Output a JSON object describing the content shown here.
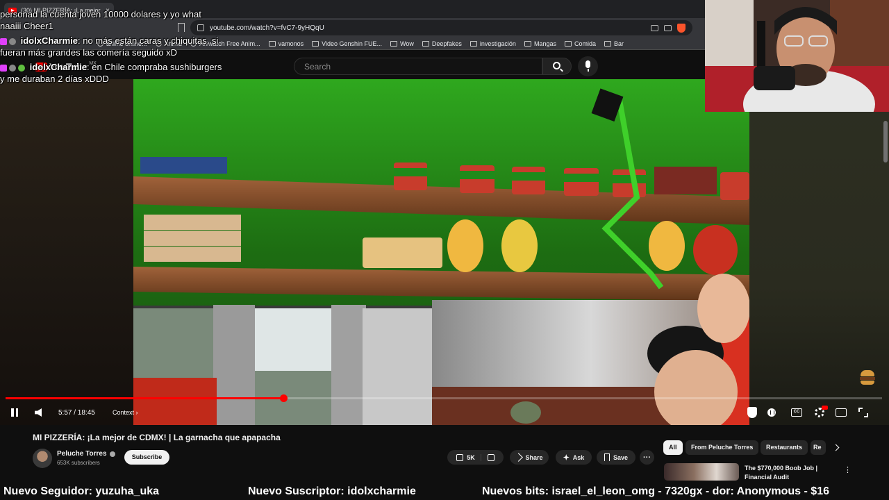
{
  "browser": {
    "tab_title": "(30) MI PIZZERÍA: ¡La mejor d",
    "tab_close": "×",
    "url": "youtube.com/watch?v=fvC7-9yHQqU",
    "bookmarks": [
      {
        "label": "anime online...",
        "icon": "globe-icon"
      },
      {
        "label": "Animu",
        "icon": "globe-icon"
      },
      {
        "label": "Aniwatch Free Anim...",
        "icon": "globe-icon"
      },
      {
        "label": "vamonos",
        "icon": "folder-icon"
      },
      {
        "label": "Video Genshin FUE...",
        "icon": "folder-icon"
      },
      {
        "label": "Wow",
        "icon": "folder-icon"
      },
      {
        "label": "Deepfakes",
        "icon": "folder-icon"
      },
      {
        "label": "investigación",
        "icon": "folder-icon"
      },
      {
        "label": "Mangas",
        "icon": "folder-icon"
      },
      {
        "label": "Comida",
        "icon": "folder-icon"
      },
      {
        "label": "Bar",
        "icon": "folder-icon"
      }
    ]
  },
  "youtube": {
    "logo_text": "YouTube",
    "region": "MX",
    "search_placeholder": "Search"
  },
  "player": {
    "progress_fraction": 0.317,
    "time": "5:57 / 18:45",
    "context_label": "Context",
    "context_arrow": "›",
    "cc_label": "CC"
  },
  "video": {
    "title": "MI PIZZERÍA: ¡La mejor de CDMX! | La garnacha que apapacha",
    "channel": "Peluche Torres",
    "subscribers": "653K subscribers",
    "subscribe_label": "Subscribe",
    "likes": "5K",
    "share_label": "Share",
    "ask_label": "Ask",
    "save_label": "Save",
    "more_label": "···"
  },
  "sidebar": {
    "chips": [
      "All",
      "From Peluche Torres",
      "Restaurants",
      "Re"
    ],
    "rec_title": "The $770,000 Boob Job |",
    "rec_subtitle": "Financial Audit",
    "rec_more": "⋮"
  },
  "chat": {
    "messages": [
      {
        "user": "",
        "text": "personad la cuenta joven 10000 dolares y yo what naaiii Cheer1"
      },
      {
        "user": "idolxCharmie",
        "text": "no más están caras y chiquitas, si fueran más grandes las comería seguido xD"
      },
      {
        "user": "idolxCharmie",
        "text": "en Chile compraba sushiburgers y me duraban 2 días xDDD"
      }
    ]
  },
  "ticker": {
    "follower": "Nuevo Seguidor: yuzuha_uka",
    "subscriber": "Nuevo Suscriptor: idolxcharmie",
    "bits": "Nuevos bits: israel_el_leon_omg - 7320gx - dor: Anonymous - $16"
  },
  "colors": {
    "accent": "#ff0000",
    "background": "#0f0f0f",
    "chat_badge": "#e040fb"
  }
}
